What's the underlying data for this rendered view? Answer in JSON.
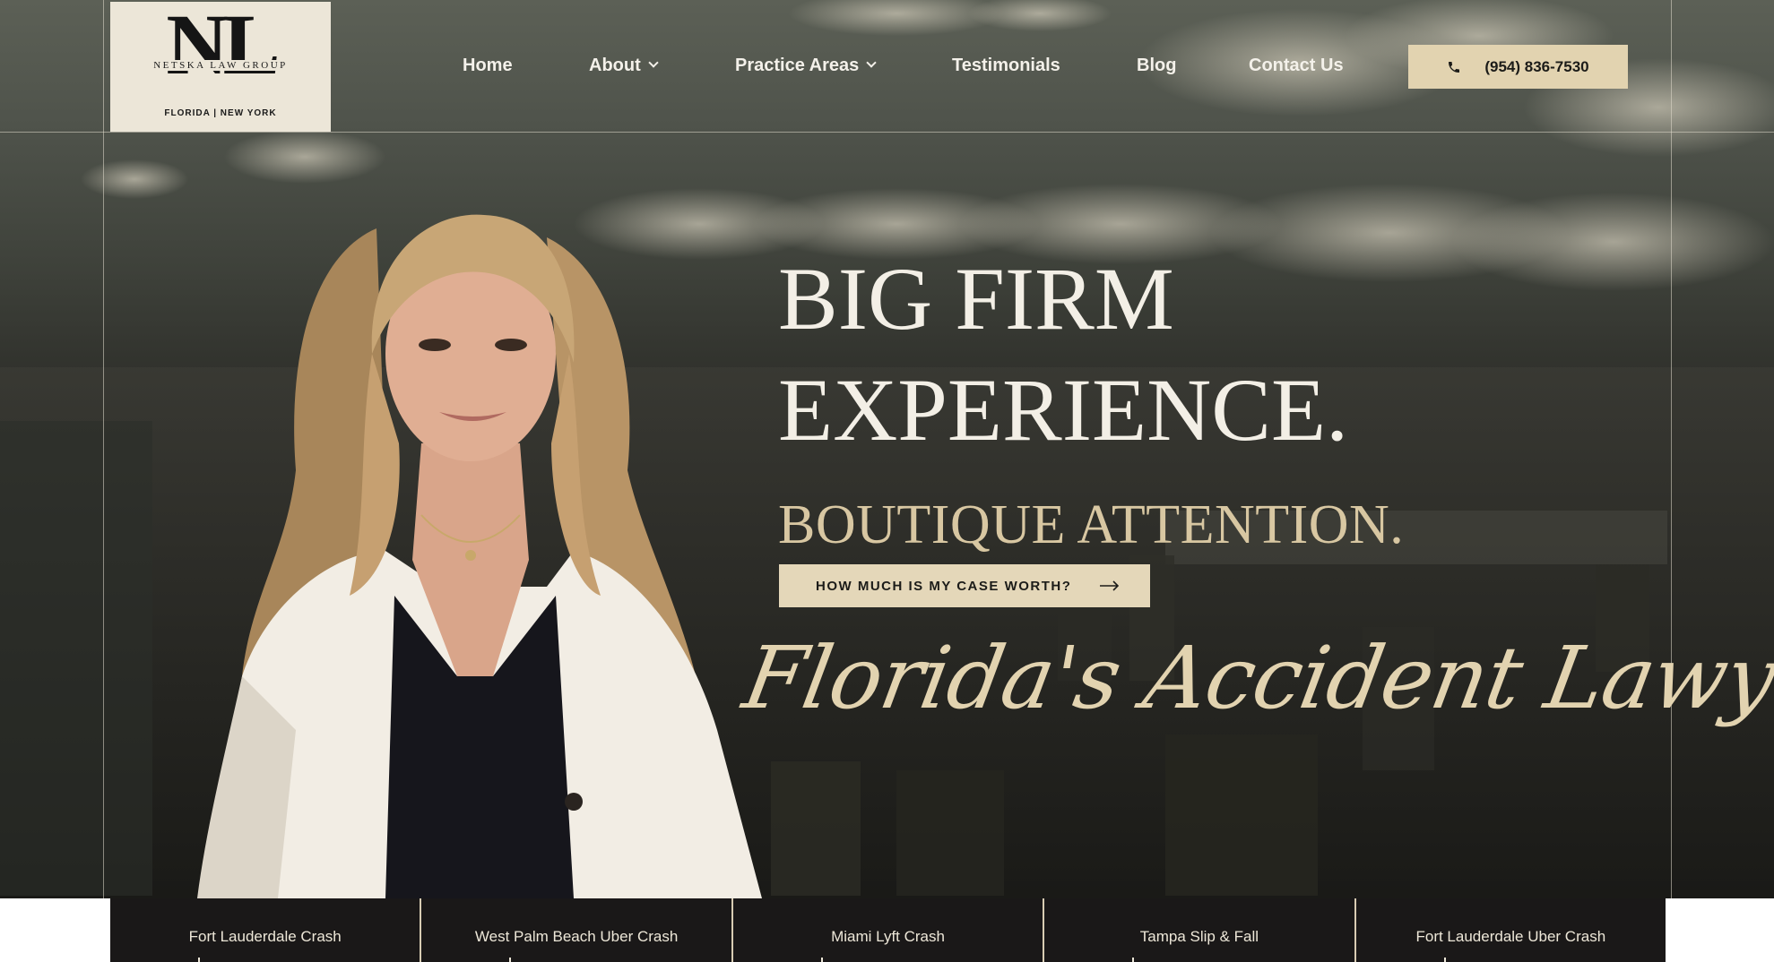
{
  "brand": {
    "monogram": "NL",
    "name": "NETSKA LAW GROUP",
    "locations": "FLORIDA  |  NEW YORK"
  },
  "nav": {
    "items": [
      {
        "label": "Home",
        "has_dropdown": false
      },
      {
        "label": "About",
        "has_dropdown": true
      },
      {
        "label": "Practice Areas",
        "has_dropdown": true
      },
      {
        "label": "Testimonials",
        "has_dropdown": false
      },
      {
        "label": "Blog",
        "has_dropdown": false
      },
      {
        "label": "Contact Us",
        "has_dropdown": false
      }
    ],
    "phone": {
      "label": "(954) 836-7530",
      "icon": "phone-icon"
    }
  },
  "hero": {
    "headline_line1": "BIG FIRM",
    "headline_line2": "EXPERIENCE.",
    "subheadline": "BOUTIQUE ATTENTION.",
    "cta_label": "HOW MUCH IS MY CASE WORTH?",
    "cta_icon": "arrow-right-icon",
    "tagline": "Florida's Accident Lawyer"
  },
  "case_tabs": [
    {
      "label": "Fort Lauderdale Crash"
    },
    {
      "label": "West Palm Beach Uber Crash"
    },
    {
      "label": "Miami Lyft Crash"
    },
    {
      "label": "Tampa Slip & Fall"
    },
    {
      "label": "Fort Lauderdale Uber Crash"
    }
  ],
  "colors": {
    "accent_beige": "#e2d3b0",
    "logo_bg": "#ece6d8",
    "hero_dark": "#1c1c19",
    "tab_bg": "#1a1818",
    "text_light": "#f3efe6"
  }
}
